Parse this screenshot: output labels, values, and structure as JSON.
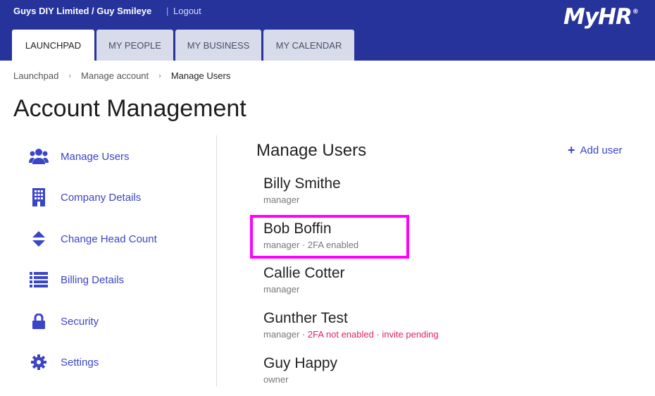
{
  "header": {
    "company": "Guys DIY Limited / Guy Smileye",
    "separator": "|",
    "logout": "Logout",
    "logo_text": "MyHR",
    "logo_mark": "®",
    "bg_color": "#26339b"
  },
  "tabs": [
    {
      "label": "LAUNCHPAD",
      "active": true
    },
    {
      "label": "MY PEOPLE",
      "active": false
    },
    {
      "label": "MY BUSINESS",
      "active": false
    },
    {
      "label": "MY CALENDAR",
      "active": false
    }
  ],
  "breadcrumb": {
    "items": [
      "Launchpad",
      "Manage account",
      "Manage Users"
    ],
    "separator": "›"
  },
  "page_title": "Account Management",
  "sidebar": {
    "accent_color": "#3b45c8",
    "items": [
      {
        "label": "Manage Users",
        "icon": "users-icon"
      },
      {
        "label": "Company Details",
        "icon": "building-icon"
      },
      {
        "label": "Change Head Count",
        "icon": "sort-icon"
      },
      {
        "label": "Billing Details",
        "icon": "list-icon"
      },
      {
        "label": "Security",
        "icon": "lock-icon"
      },
      {
        "label": "Settings",
        "icon": "gear-icon"
      }
    ]
  },
  "main": {
    "title": "Manage Users",
    "add_user_icon": "+",
    "add_user_label": "Add user",
    "users": [
      {
        "name": "Billy Smithe",
        "role": "manager",
        "extra": "",
        "warning": ""
      },
      {
        "name": "Bob Boffin",
        "role": "manager",
        "extra": "· 2FA enabled",
        "warning": ""
      },
      {
        "name": "Callie Cotter",
        "role": "manager",
        "extra": "",
        "warning": ""
      },
      {
        "name": "Gunther Test",
        "role": "manager",
        "extra": "",
        "warning": "· 2FA not enabled · invite pending"
      },
      {
        "name": "Guy Happy",
        "role": "owner",
        "extra": "",
        "warning": ""
      }
    ],
    "highlight_color": "#ff00ff",
    "warning_color": "#e0245e"
  }
}
